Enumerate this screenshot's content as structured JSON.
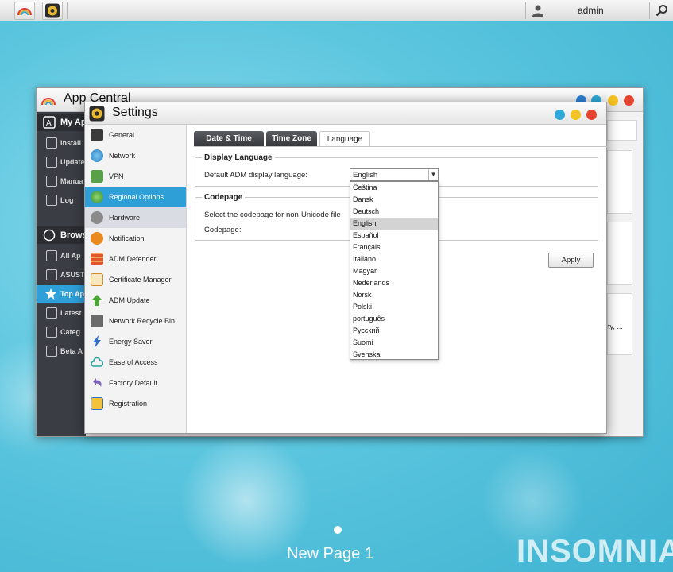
{
  "taskbar": {
    "user": "admin"
  },
  "app_central": {
    "title": "App Central",
    "sidebar": {
      "section1": "My Ap",
      "items1": [
        "Install",
        "Update",
        "Manua",
        "Log"
      ],
      "section2": "Brows",
      "items2": [
        "All Ap",
        "ASUST",
        "Top Ap",
        "Latest",
        "Categ",
        "Beta A"
      ]
    },
    "snippet": "ty, ..."
  },
  "settings": {
    "title": "Settings",
    "nav": [
      {
        "label": "General",
        "icon": "server-icon"
      },
      {
        "label": "Network",
        "icon": "globe-icon"
      },
      {
        "label": "VPN",
        "icon": "vpn-icon"
      },
      {
        "label": "Regional Options",
        "icon": "globe-icon"
      },
      {
        "label": "Hardware",
        "icon": "hardware-icon"
      },
      {
        "label": "Notification",
        "icon": "alert-icon"
      },
      {
        "label": "ADM Defender",
        "icon": "firewall-icon"
      },
      {
        "label": "Certificate Manager",
        "icon": "certificate-icon"
      },
      {
        "label": "ADM Update",
        "icon": "arrow-up-icon"
      },
      {
        "label": "Network Recycle Bin",
        "icon": "trash-icon"
      },
      {
        "label": "Energy Saver",
        "icon": "lightning-icon"
      },
      {
        "label": "Ease of Access",
        "icon": "cloud-icon"
      },
      {
        "label": "Factory Default",
        "icon": "undo-icon"
      },
      {
        "label": "Registration",
        "icon": "document-icon"
      }
    ],
    "tabs": [
      "Date & Time",
      "Time Zone",
      "Language"
    ],
    "display_language": {
      "legend": "Display Language",
      "label": "Default ADM display language:",
      "selected": "English",
      "options": [
        "Čeština",
        "Dansk",
        "Deutsch",
        "English",
        "Español",
        "Français",
        "Italiano",
        "Magyar",
        "Nederlands",
        "Norsk",
        "Polski",
        "português",
        "Русский",
        "Suomi",
        "Svenska"
      ]
    },
    "codepage": {
      "legend": "Codepage",
      "description": "Select the codepage for non-Unicode file",
      "label": "Codepage:"
    },
    "apply": "Apply"
  },
  "desktop": {
    "page_label": "New Page 1",
    "watermark": "INSOMNIA"
  },
  "colors": {
    "accent": "#2f9fd8",
    "tab_dark": "#3a3c40"
  }
}
